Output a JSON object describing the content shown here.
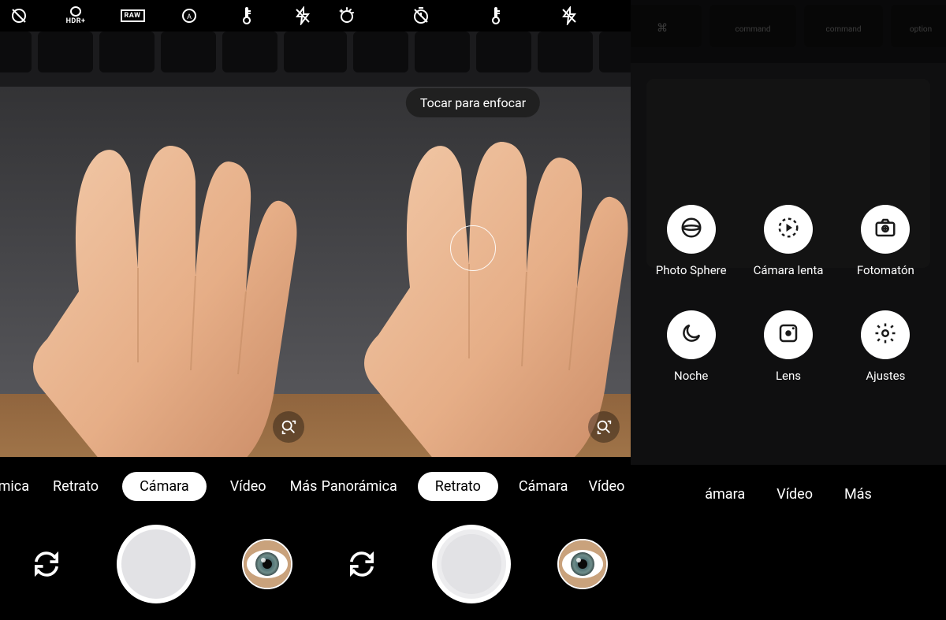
{
  "panel1": {
    "top_icons": [
      "motion-off",
      "hdr-plus",
      "raw",
      "wb-auto",
      "thermometer",
      "flash-off"
    ],
    "modes": [
      {
        "label": "mica"
      },
      {
        "label": "Retrato"
      },
      {
        "label": "Cámara",
        "selected": true
      },
      {
        "label": "Vídeo"
      },
      {
        "label": "Más"
      }
    ]
  },
  "panel2": {
    "top_icons": [
      "timer-effects",
      "timer-off",
      "thermometer",
      "flash-off"
    ],
    "hint": "Tocar para enfocar",
    "modes": [
      {
        "label": "Panorámica"
      },
      {
        "label": "Retrato",
        "selected": true
      },
      {
        "label": "Cámara"
      },
      {
        "label": "Vídeo"
      }
    ]
  },
  "panel3": {
    "modes": [
      {
        "label": "ámara"
      },
      {
        "label": "Vídeo"
      },
      {
        "label": "Más",
        "selected": true
      }
    ],
    "more_items": [
      {
        "label": "Photo Sphere",
        "icon": "photosphere"
      },
      {
        "label": "Cámara lenta",
        "icon": "slowmo"
      },
      {
        "label": "Fotomatón",
        "icon": "photobooth"
      },
      {
        "label": "Noche",
        "icon": "night"
      },
      {
        "label": "Lens",
        "icon": "lens"
      },
      {
        "label": "Ajustes",
        "icon": "settings"
      }
    ]
  }
}
